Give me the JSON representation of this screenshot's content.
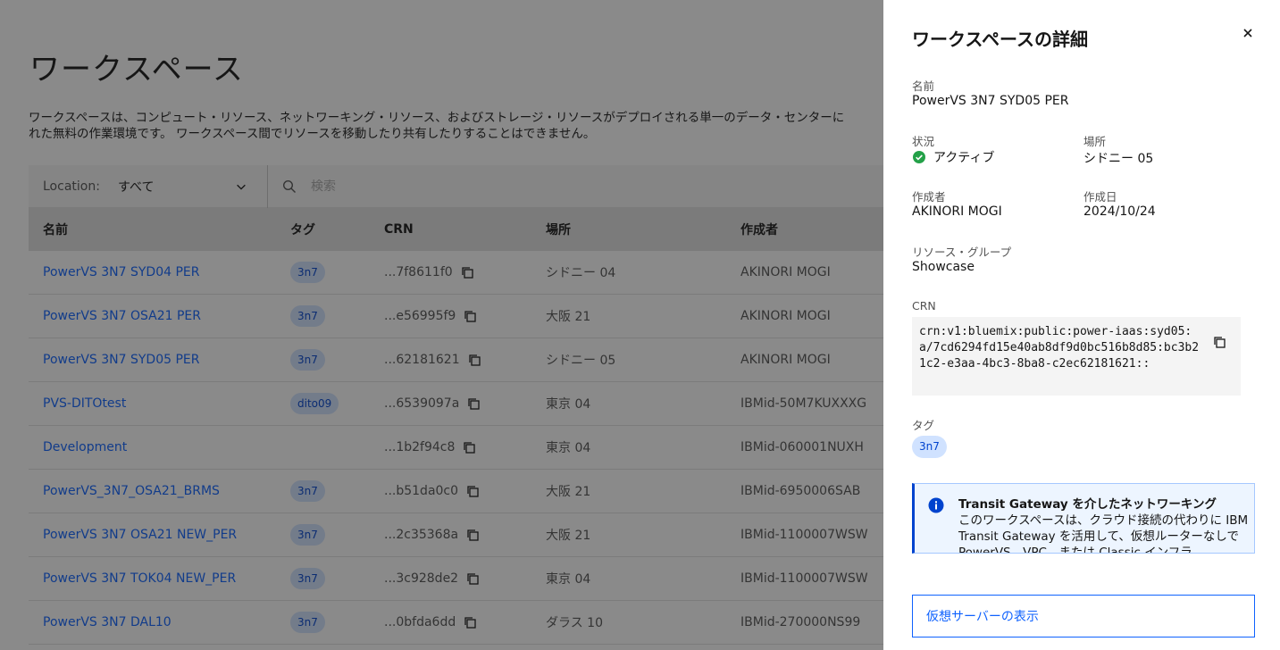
{
  "page": {
    "title": "ワークスペース",
    "description_line1": "ワークスペースは、コンピュート・リソース、ネットワーキング・リソース、およびストレージ・リソースがデプロイされる単一のデータ・センターに",
    "description_line2": "れた無料の作業環境です。 ワークスペース間でリソースを移動したり共有したりすることはできません。"
  },
  "toolbar": {
    "location_label": "Location:",
    "location_value": "すべて",
    "search_placeholder": "検索"
  },
  "table": {
    "headers": [
      "名前",
      "タグ",
      "CRN",
      "場所",
      "作成者"
    ],
    "rows": [
      {
        "name": "PowerVS 3N7 SYD04 PER",
        "tag": "3n7",
        "crn": "...7f8611f0",
        "location": "シドニー 04",
        "creator": "AKINORI MOGI"
      },
      {
        "name": "PowerVS 3N7 OSA21 PER",
        "tag": "3n7",
        "crn": "...e56995f9",
        "location": "大阪 21",
        "creator": "AKINORI MOGI"
      },
      {
        "name": "PowerVS 3N7 SYD05 PER",
        "tag": "3n7",
        "crn": "...62181621",
        "location": "シドニー 05",
        "creator": "AKINORI MOGI"
      },
      {
        "name": "PVS-DITOtest",
        "tag": "dito09",
        "crn": "...6539097a",
        "location": "東京 04",
        "creator": "IBMid-50M7KUXXXG"
      },
      {
        "name": "Development",
        "tag": "",
        "crn": "...1b2f94c8",
        "location": "東京 04",
        "creator": "IBMid-060001NUXH"
      },
      {
        "name": "PowerVS_3N7_OSA21_BRMS",
        "tag": "3n7",
        "crn": "...b51da0c0",
        "location": "大阪 21",
        "creator": "IBMid-6950006SAB"
      },
      {
        "name": "PowerVS 3N7 OSA21 NEW_PER",
        "tag": "3n7",
        "crn": "...2c35368a",
        "location": "大阪 21",
        "creator": "IBMid-1100007WSW"
      },
      {
        "name": "PowerVS 3N7 TOK04 NEW_PER",
        "tag": "3n7",
        "crn": "...3c928de2",
        "location": "東京 04",
        "creator": "IBMid-1100007WSW"
      },
      {
        "name": "PowerVS 3N7 DAL10",
        "tag": "3n7",
        "crn": "...0bfda6dd",
        "location": "ダラス 10",
        "creator": "IBMid-270000NS99"
      }
    ]
  },
  "panel": {
    "title": "ワークスペースの詳細",
    "name_label": "名前",
    "name_value": "PowerVS 3N7 SYD05 PER",
    "status_label": "状況",
    "status_value": "アクティブ",
    "location_label": "場所",
    "location_value": "シドニー 05",
    "creator_label": "作成者",
    "creator_value": "AKINORI MOGI",
    "created_label": "作成日",
    "created_value": "2024/10/24",
    "rg_label": "リソース・グループ",
    "rg_value": "Showcase",
    "crn_label": "CRN",
    "crn_value": "crn:v1:bluemix:public:power-iaas:syd05:a/7cd6294fd15e40ab8df9d0bc516b8d85:bc3b21c2-e3aa-4bc3-8ba8-c2ec62181621::",
    "tags_label": "タグ",
    "tag_value": "3n7",
    "notice_title": "Transit Gateway を介したネットワーキング",
    "notice_body": "このワークスペースは、クラウド接続の代わりに IBM Transit Gateway を活用して、仮想ルーターなしで PowerVS、VPC、または Classic インフラ",
    "view_servers_button": "仮想サーバーの表示"
  },
  "colors": {
    "link": "#0f62fe",
    "tag_bg": "#d0e2ff",
    "tag_text": "#0043ce",
    "success": "#24a148",
    "notice_bg": "#edf5ff"
  },
  "icons": [
    "close-icon",
    "chevron-down-icon",
    "search-icon",
    "copy-icon",
    "checkmark-filled-icon",
    "information-filled-icon"
  ]
}
